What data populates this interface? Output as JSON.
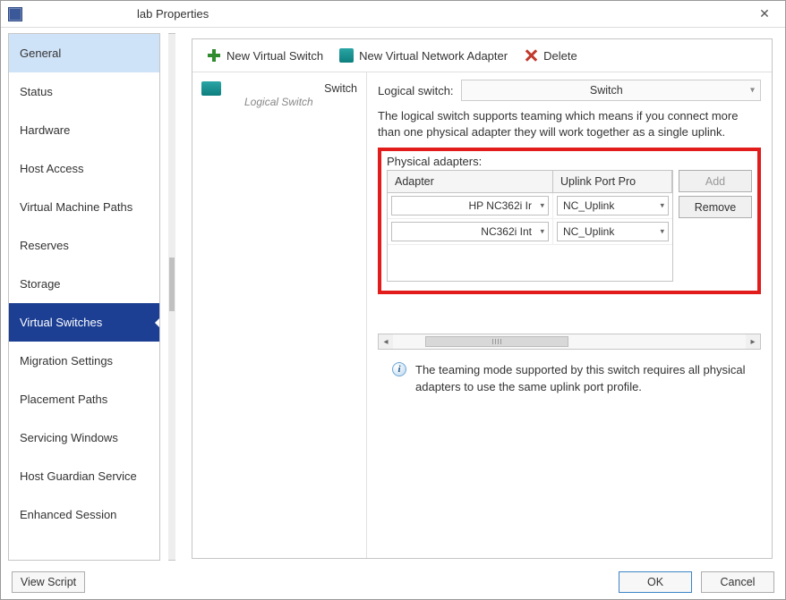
{
  "window": {
    "title": "lab Properties"
  },
  "sidebar": {
    "items": [
      {
        "label": "General"
      },
      {
        "label": "Status"
      },
      {
        "label": "Hardware"
      },
      {
        "label": "Host Access"
      },
      {
        "label": "Virtual Machine Paths"
      },
      {
        "label": "Reserves"
      },
      {
        "label": "Storage"
      },
      {
        "label": "Virtual Switches"
      },
      {
        "label": "Migration Settings"
      },
      {
        "label": "Placement Paths"
      },
      {
        "label": "Servicing Windows"
      },
      {
        "label": "Host Guardian Service"
      },
      {
        "label": "Enhanced Session"
      }
    ]
  },
  "toolbar": {
    "new_switch": "New Virtual Switch",
    "new_adapter": "New Virtual Network Adapter",
    "delete": "Delete"
  },
  "switch_list": {
    "items": [
      {
        "name": "Switch",
        "sub": "Logical Switch"
      }
    ]
  },
  "details": {
    "logical_switch_label": "Logical switch:",
    "logical_switch_value": "Switch",
    "description": "The logical switch supports teaming which means if you connect more than one physical adapter they will work together as a single uplink.",
    "physical_adapters_label": "Physical adapters:",
    "table": {
      "headers": {
        "adapter": "Adapter",
        "uplink": "Uplink Port Pro"
      },
      "rows": [
        {
          "adapter": "HP NC362i Ir",
          "uplink": "NC_Uplink"
        },
        {
          "adapter": "NC362i Int",
          "uplink": "NC_Uplink"
        }
      ]
    },
    "buttons": {
      "add": "Add",
      "remove": "Remove"
    },
    "info": "The teaming mode supported by this switch requires all physical adapters to use the same uplink port profile."
  },
  "footer": {
    "view_script": "View Script",
    "ok": "OK",
    "cancel": "Cancel"
  }
}
